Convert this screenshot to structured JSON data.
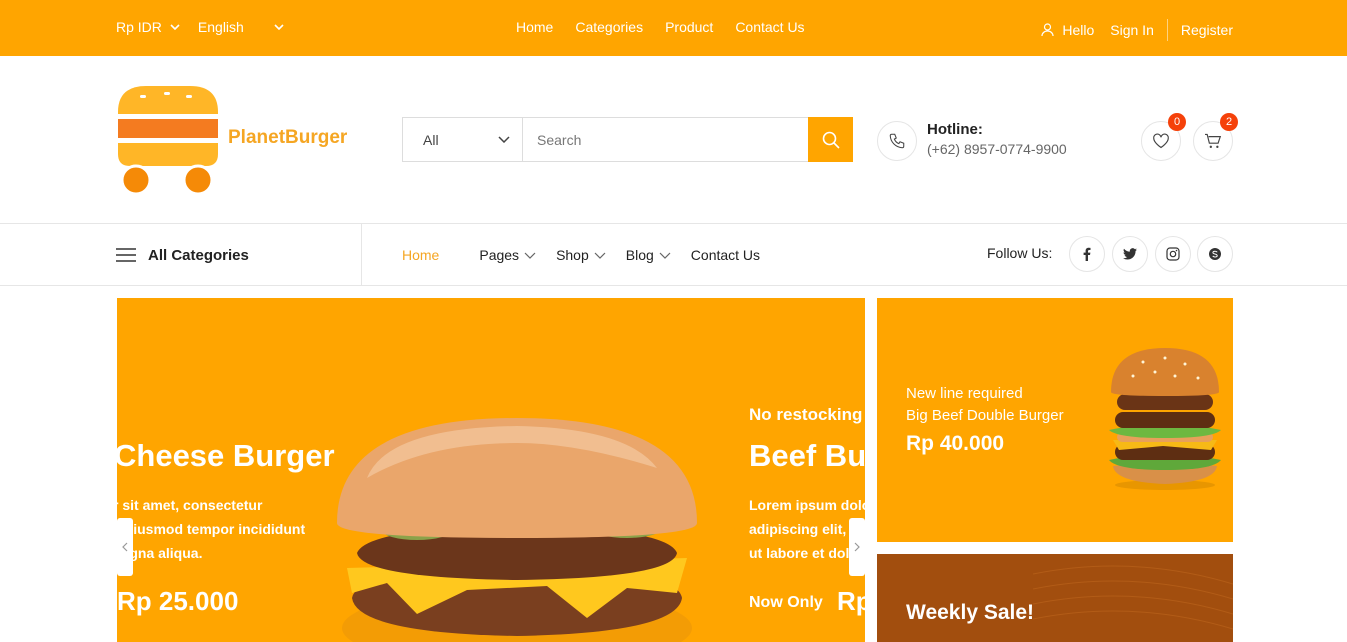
{
  "topbar": {
    "currency": "Rp IDR",
    "language": "English",
    "nav": [
      "Home",
      "Categories",
      "Product",
      "Contact Us"
    ],
    "hello": "Hello",
    "sign_in": "Sign In",
    "register": "Register"
  },
  "header": {
    "brand": "PlanetBurger",
    "search_category": "All",
    "search_placeholder": "Search",
    "hotline_title": "Hotline:",
    "hotline_number": "(+62) 8957-0774-9900",
    "wishlist_count": "0",
    "cart_count": "2"
  },
  "navbar": {
    "all_categories": "All Categories",
    "items": [
      "Home",
      "Pages",
      "Shop",
      "Blog",
      "Contact Us"
    ],
    "follow": "Follow Us:"
  },
  "hero": {
    "slide1_title": "Cheese Burger",
    "slide1_desc": "r sit amet, consectetur\no eiusmod tempor incididunt\nnagna aliqua.",
    "slide1_price": "Rp 25.000",
    "slide2_pre": "No restocking",
    "slide2_title": "Beef Bur",
    "slide2_desc": "Lorem ipsum dolo\nadipiscing elit, s\nut labore et dol",
    "slide2_now": "Now Only",
    "slide2_price": "Rp"
  },
  "promo1": {
    "line1": "New line required",
    "line2": "Big Beef Double Burger",
    "price": "Rp 40.000"
  },
  "promo2": {
    "title": "Weekly Sale!"
  },
  "colors": {
    "accent": "#FFA500",
    "brand": "#F5A623",
    "badge": "#F5410A",
    "promo_brown": "#A24E0E"
  },
  "icons": [
    "chevron-down-icon",
    "user-icon",
    "search-icon",
    "phone-icon",
    "heart-icon",
    "cart-icon",
    "menu-icon",
    "facebook-icon",
    "twitter-icon",
    "instagram-icon",
    "skype-icon",
    "chevron-left-icon",
    "chevron-right-icon"
  ]
}
